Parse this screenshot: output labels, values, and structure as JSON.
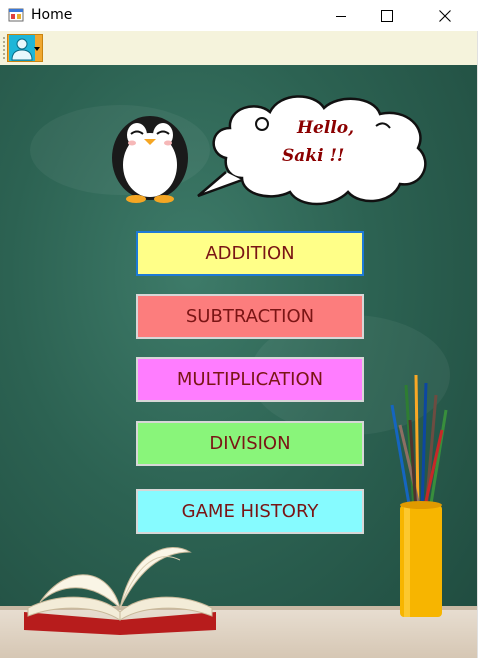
{
  "window": {
    "title": "Home"
  },
  "toolbar": {
    "user_dropdown_icon": "user-icon"
  },
  "greeting": {
    "line1": "Hello,",
    "line2": "Saki !!"
  },
  "menu": {
    "addition": "ADDITION",
    "subtraction": "SUBTRACTION",
    "multiplication": "MULTIPLICATION",
    "division": "DIVISION",
    "game_history": "GAME HISTORY"
  },
  "colors": {
    "addition": "#ffff88",
    "subtraction": "#fc7d7d",
    "multiplication": "#ff7dff",
    "division": "#89f57a",
    "game_history": "#86fbff",
    "button_text": "#7a1515",
    "chalkboard": "#2c6252"
  }
}
